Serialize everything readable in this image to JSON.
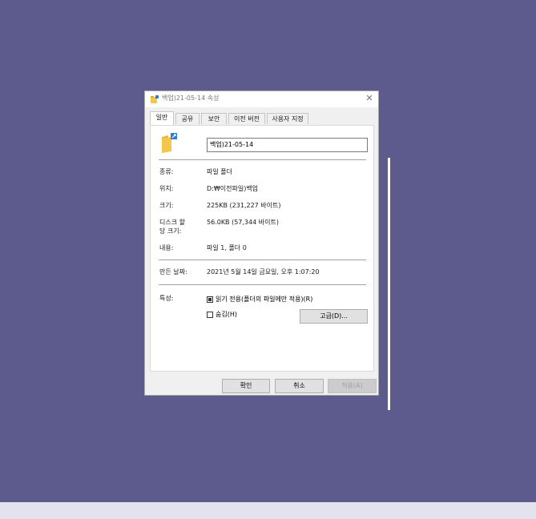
{
  "window": {
    "title": "백업)21-05-14 속성",
    "close_icon": "close-icon"
  },
  "tabs": [
    {
      "label": "일반",
      "active": true
    },
    {
      "label": "공유",
      "active": false
    },
    {
      "label": "보안",
      "active": false
    },
    {
      "label": "이전 버전",
      "active": false
    },
    {
      "label": "사용자 지정",
      "active": false
    }
  ],
  "general": {
    "folder_name": "백업)21-05-14",
    "type_label": "종류:",
    "type_value": "파일 폴더",
    "location_label": "위치:",
    "location_value": "D:₩이전파일)백업",
    "size_label": "크기:",
    "size_value": "225KB (231,227 바이트)",
    "disk_size_label": "디스크 할\n당 크기:",
    "disk_size_label_line1": "디스크 할",
    "disk_size_label_line2": "당 크기:",
    "disk_size_value": "56.0KB (57,344 바이트)",
    "contents_label": "내용:",
    "contents_value": "파일 1, 폴더 0",
    "created_label": "만든 날짜:",
    "created_value": "2021년 5월 14일 금요일, 오후 1:07:20",
    "attributes_label": "특성:",
    "readonly_label": "읽기 전용(폴더의 파일에만 적용)(R)",
    "readonly_state": "indeterminate",
    "hidden_label": "숨김(H)",
    "hidden_state": "unchecked",
    "advanced_button": "고급(D)..."
  },
  "footer": {
    "ok_button": "확인",
    "cancel_button": "취소",
    "apply_button": "적용(A)"
  },
  "colors": {
    "desktop": "#5d5b8d",
    "dialog_bg": "#f0f0f0",
    "folder_yellow": "#f4c64c",
    "shortcut_blue": "#2f7bd8"
  }
}
